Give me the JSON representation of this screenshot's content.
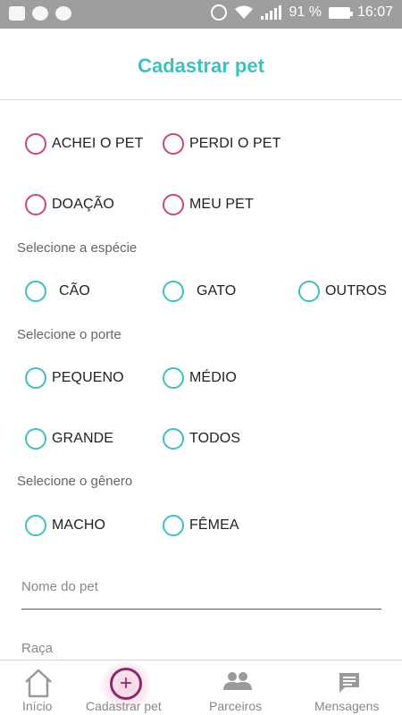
{
  "status_bar": {
    "battery": "91 %",
    "time": "16:07"
  },
  "header": {
    "title": "Cadastrar pet"
  },
  "situation": {
    "options": [
      "ACHEI O PET",
      "PERDI O PET",
      "DOAÇÃO",
      "MEU PET"
    ]
  },
  "species": {
    "label": "Selecione a espécie",
    "options": [
      "CÃO",
      "GATO",
      "OUTROS"
    ]
  },
  "size": {
    "label": "Selecione o porte",
    "options": [
      "PEQUENO",
      "MÉDIO",
      "GRANDE",
      "TODOS"
    ]
  },
  "gender": {
    "label": "Selecione o gênero",
    "options": [
      "MACHO",
      "FÊMEA"
    ]
  },
  "form": {
    "pet_name_placeholder": "Nome do pet",
    "breed_placeholder": "Raça"
  },
  "bottom_nav": {
    "items": [
      "Início",
      "Cadastrar pet",
      "Parceiros",
      "Mensagens"
    ]
  },
  "colors": {
    "accent": "#3fbfbf",
    "radio_situation": "#c94870",
    "radio_other": "#3fbfbf",
    "nav_active": "#8a2a6a"
  }
}
